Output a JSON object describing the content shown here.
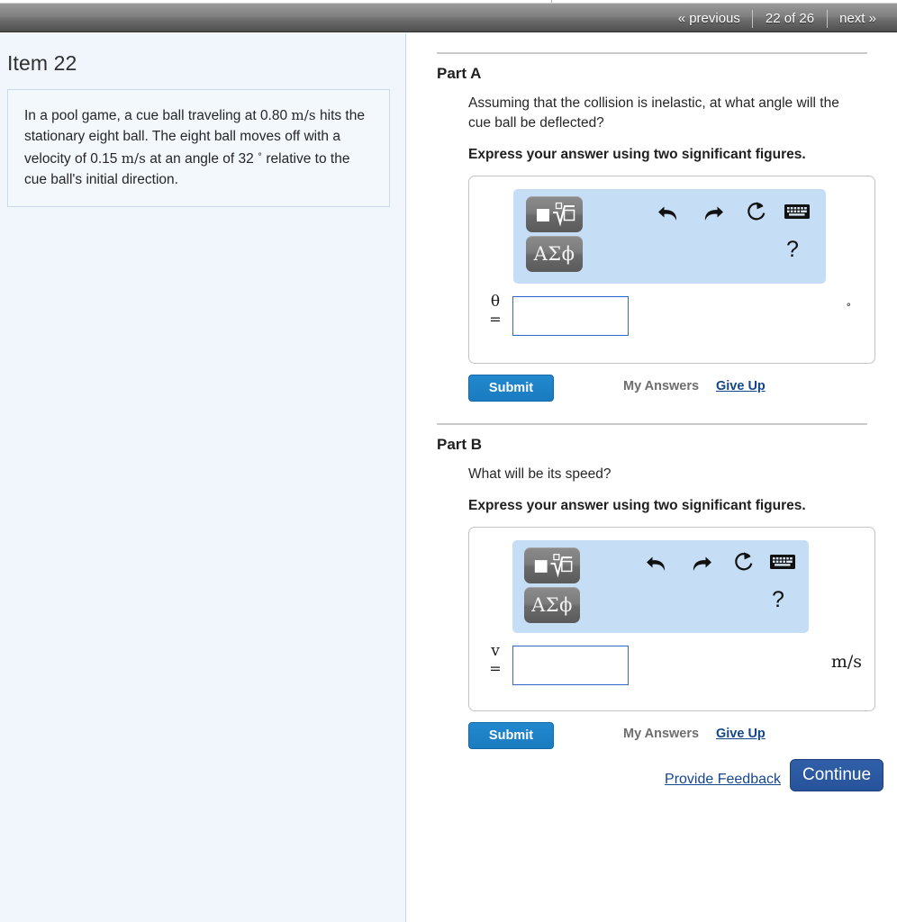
{
  "topbar": {
    "previous_label": "« previous",
    "counter_label": "22 of 26",
    "next_label": "next »"
  },
  "left_panel": {
    "item_title": "Item 22",
    "problem": {
      "seg1": "In a pool game, a cue ball traveling at 0.80 ",
      "unit1": "m/s",
      "seg2": " hits the stationary eight ball. The eight ball moves off with a velocity of 0.15 ",
      "unit2": "m/s",
      "seg3": " at an angle of 32 ",
      "degree": "°",
      "seg4": " relative to the cue ball's initial direction."
    }
  },
  "parts": [
    {
      "heading": "Part A",
      "question": "Assuming that the collision is inelastic, at what angle will the cue ball be deflected?",
      "instruction": "Express your answer using two significant figures.",
      "variable": "θ",
      "equals": "=",
      "value": "",
      "unit": "°",
      "toolbar": {
        "root_button": "root-template-button",
        "greek_button": "ΑΣϕ",
        "undo": "undo-icon",
        "redo": "redo-icon",
        "reset": "reset-icon",
        "keyboard": "keyboard-icon",
        "help": "?"
      },
      "submit_label": "Submit",
      "my_answers_label": "My Answers",
      "give_up_label": "Give Up"
    },
    {
      "heading": "Part B",
      "question": "What will be its speed?",
      "instruction": "Express your answer using two significant figures.",
      "variable": "v",
      "equals": "=",
      "value": "",
      "unit": "m/s",
      "toolbar": {
        "root_button": "root-template-button",
        "greek_button": "ΑΣϕ",
        "undo": "undo-icon",
        "redo": "redo-icon",
        "reset": "reset-icon",
        "keyboard": "keyboard-icon",
        "help": "?"
      },
      "submit_label": "Submit",
      "my_answers_label": "My Answers",
      "give_up_label": "Give Up"
    }
  ],
  "footer": {
    "provide_feedback_label": "Provide Feedback",
    "continue_label": "Continue"
  },
  "colors": {
    "link_blue": "#14458f",
    "submit_blue": "#1a7cc0",
    "continue_blue": "#27539b",
    "toolbar_blue": "#c6ddf6",
    "panel_bg": "#f1f6fd",
    "input_border": "#3366cc"
  }
}
